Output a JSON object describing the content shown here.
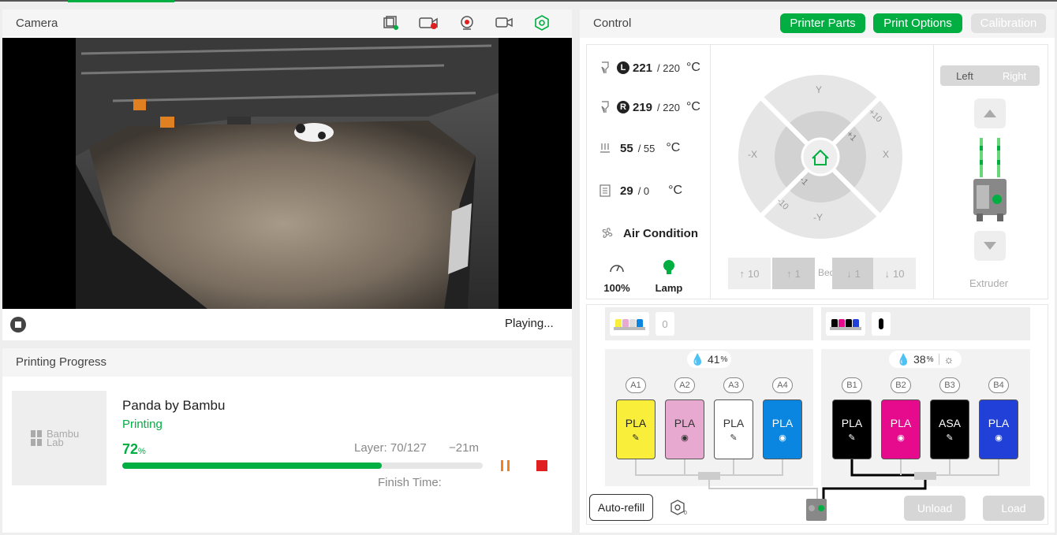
{
  "camera": {
    "title": "Camera",
    "status": "Playing..."
  },
  "progress": {
    "title": "Printing Progress",
    "thumb_logo_line1": "Bambu",
    "thumb_logo_line2": "Lab",
    "job_name": "Panda by Bambu",
    "state": "Printing",
    "percent_value": "72",
    "percent_unit": "%",
    "percent_fraction": 0.72,
    "layer": "Layer: 70/127",
    "remaining": "−21m",
    "finish_time_label": "Finish Time:"
  },
  "control": {
    "title": "Control",
    "buttons": {
      "printer_parts": "Printer Parts",
      "print_options": "Print Options",
      "calibration": "Calibration"
    },
    "temps": {
      "left_nozzle_badge": "L",
      "left_nozzle_current": "221",
      "left_nozzle_target": "/ 220",
      "right_nozzle_badge": "R",
      "right_nozzle_current": "219",
      "right_nozzle_target": "/ 220",
      "bed_current": "55",
      "bed_target": "/ 55",
      "chamber_current": "29",
      "chamber_target": "/ 0",
      "unit": "°C"
    },
    "air_condition": "Air Condition",
    "speed": "100%",
    "lamp": "Lamp",
    "jog": {
      "y_plus": "Y",
      "y_minus": "-Y",
      "x_plus": "X",
      "x_minus": "-X",
      "plus10": "+10",
      "plus1": "+1",
      "minus1": "-1",
      "minus10": "-10"
    },
    "bed_controls": {
      "up10": "10",
      "up1": "1",
      "label": "Bed",
      "down1": "1",
      "down10": "10"
    },
    "extruder": {
      "left": "Left",
      "right": "Right",
      "label": "Extruder"
    }
  },
  "ams": {
    "unit_a_count": "0",
    "unit_a_humidity": "41",
    "unit_b_humidity": "38",
    "humidity_unit": "%",
    "slots_a": [
      {
        "label": "A1",
        "type": "PLA",
        "color": "#f9ee3a",
        "text": "#222"
      },
      {
        "label": "A2",
        "type": "PLA",
        "color": "#e8a9d0",
        "text": "#333"
      },
      {
        "label": "A3",
        "type": "PLA",
        "color": "#ffffff",
        "text": "#333"
      },
      {
        "label": "A4",
        "type": "PLA",
        "color": "#0a86e0",
        "text": "#ffffff"
      }
    ],
    "slots_b": [
      {
        "label": "B1",
        "type": "PLA",
        "color": "#000000",
        "text": "#ffffff"
      },
      {
        "label": "B2",
        "type": "PLA",
        "color": "#e60a8c",
        "text": "#ffffff"
      },
      {
        "label": "B3",
        "type": "ASA",
        "color": "#000000",
        "text": "#ffffff"
      },
      {
        "label": "B4",
        "type": "PLA",
        "color": "#2040d8",
        "text": "#ffffff"
      }
    ],
    "auto_refill": "Auto-refill",
    "unload": "Unload",
    "load": "Load"
  },
  "colors": {
    "accent": "#00ae42",
    "pause": "#f08020",
    "stop": "#e02020"
  }
}
